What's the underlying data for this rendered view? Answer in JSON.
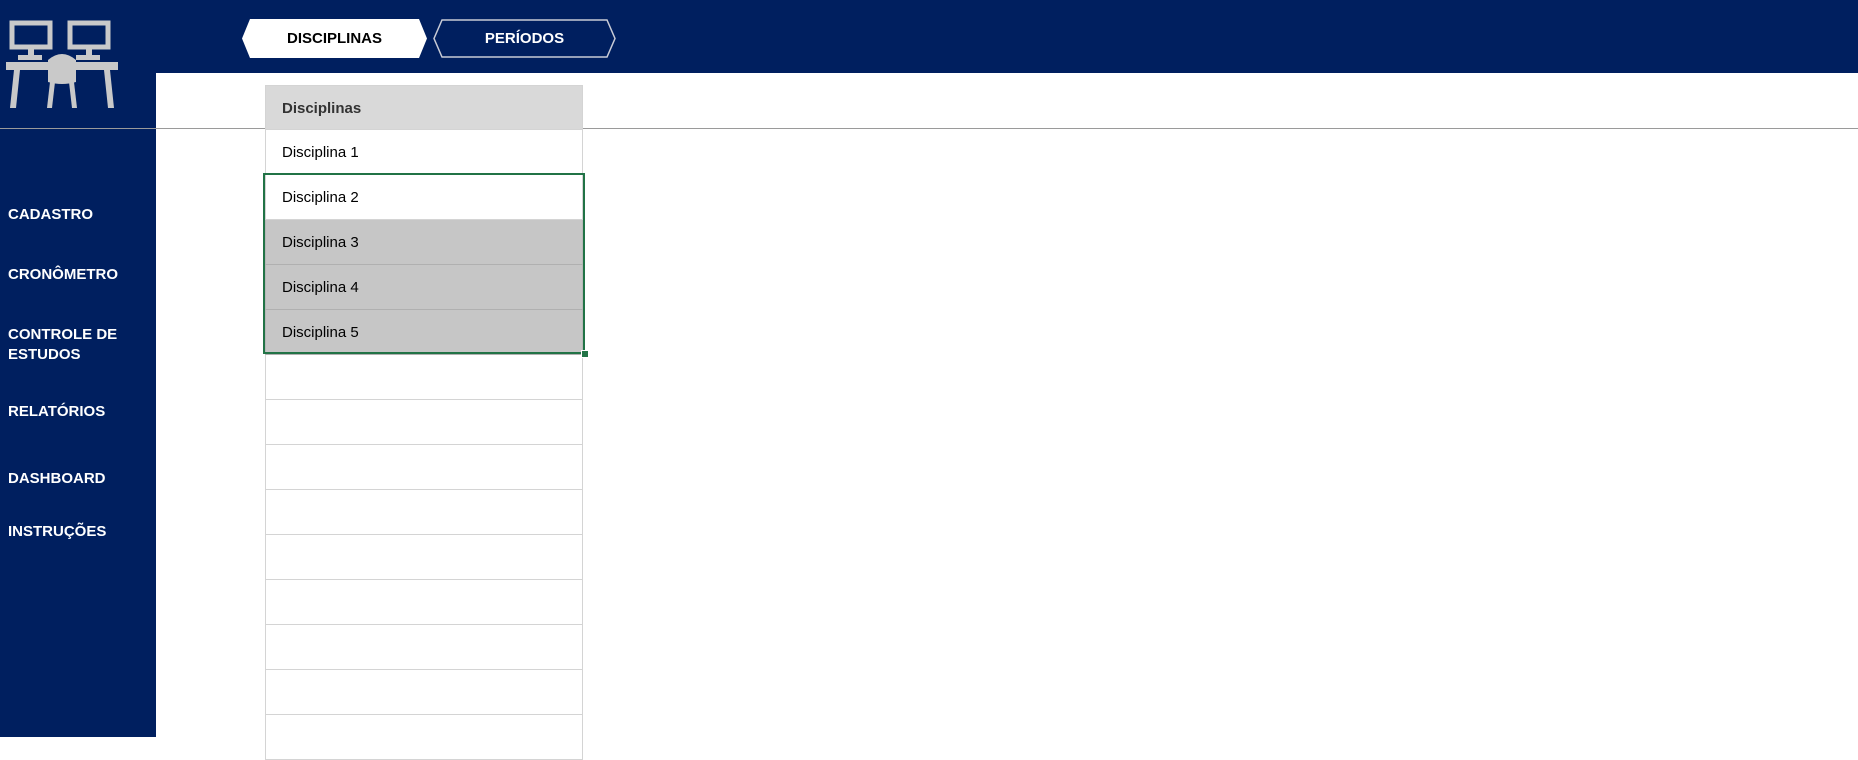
{
  "tabs": [
    {
      "label": "DISCIPLINAS",
      "active": true
    },
    {
      "label": "PERÍODOS",
      "active": false
    }
  ],
  "sidebar": {
    "items": [
      {
        "label": "CADASTRO"
      },
      {
        "label": "CRONÔMETRO"
      },
      {
        "label": "CONTROLE DE ESTUDOS"
      },
      {
        "label": "RELATÓRIOS"
      },
      {
        "label": "DASHBOARD"
      },
      {
        "label": "INSTRUÇÕES"
      }
    ]
  },
  "table": {
    "header": "Disciplinas",
    "rows": [
      "Disciplina 1",
      "Disciplina 2",
      "Disciplina 3",
      "Disciplina 4",
      "Disciplina 5",
      "",
      "",
      "",
      "",
      "",
      "",
      "",
      "",
      ""
    ]
  },
  "colors": {
    "navy": "#001f5f",
    "header_gray": "#d9d9d9",
    "shaded_gray": "#c6c6c6",
    "selection_green": "#217346"
  },
  "icons": {
    "logo": "desk-workstation-icon"
  }
}
